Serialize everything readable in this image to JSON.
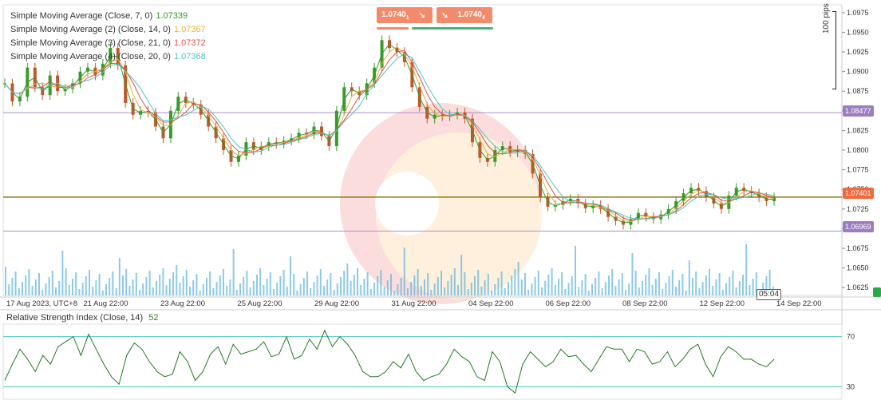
{
  "legend": [
    {
      "label": "Simple Moving Average (Close, 7, 0)",
      "value": "1.07339",
      "color": "#2e9a2e"
    },
    {
      "label": "Simple Moving Average (2) (Close, 14, 0)",
      "value": "1.07367",
      "color": "#e8b23c"
    },
    {
      "label": "Simple Moving Average (3) (Close, 21, 0)",
      "value": "1.07372",
      "color": "#e0504b"
    },
    {
      "label": "Simple Moving Average (4) (Close, 20, 0)",
      "value": "1.07368",
      "color": "#4cc4c0"
    }
  ],
  "trade": {
    "sell_price": "1.0740",
    "sell_sup": "1",
    "buy_price": "1.0740",
    "buy_sup": "4",
    "sell_arrow": "↘",
    "buy_arrow": "↘"
  },
  "pips_label": "100 pips",
  "price_tags": {
    "upper_line": "1.08477",
    "current": "1.07401",
    "lower_line": "1.06969"
  },
  "time_tag": "05:04",
  "rsi_legend": {
    "label": "Relative Strength Index (Close, 14)",
    "value": "52",
    "color": "#2a8a2a"
  },
  "chart_data": {
    "type": "line",
    "title": "",
    "y_axis_ticks": [
      "1.0975",
      "1.0950",
      "1.0925",
      "1.0900",
      "1.0875",
      "1.0850",
      "1.0825",
      "1.0800",
      "1.0775",
      "1.0750",
      "1.0725",
      "1.0700",
      "1.0675",
      "1.0650",
      "1.0625"
    ],
    "ylim": [
      1.0615,
      1.0985
    ],
    "x_axis_ticks": [
      "17 Aug 2023, UTC+8",
      "21 Aug 22:00",
      "23 Aug 22:00",
      "25 Aug 22:00",
      "29 Aug 22:00",
      "31 Aug 22:00",
      "04 Sep 22:00",
      "06 Sep 22:00",
      "08 Sep 22:00",
      "12 Sep 22:00",
      "14 Sep 22:00"
    ],
    "horizontal_levels": [
      1.08477,
      1.07401,
      1.06969
    ],
    "price_series": [
      1.0885,
      1.0862,
      1.0868,
      1.0905,
      1.088,
      1.087,
      1.0895,
      1.0875,
      1.0878,
      1.0885,
      1.09,
      1.0905,
      1.0895,
      1.091,
      1.093,
      1.0908,
      1.086,
      1.0845,
      1.085,
      1.0848,
      1.083,
      1.0815,
      1.085,
      1.0868,
      1.086,
      1.0858,
      1.0845,
      1.083,
      1.0815,
      1.08,
      1.0785,
      1.0793,
      1.081,
      1.08,
      1.0805,
      1.081,
      1.0808,
      1.0812,
      1.0815,
      1.0822,
      1.082,
      1.083,
      1.0818,
      1.0805,
      1.085,
      1.088,
      1.0875,
      1.087,
      1.0885,
      1.0905,
      1.094,
      1.093,
      1.0925,
      1.0912,
      1.088,
      1.0855,
      1.084,
      1.0845,
      1.0843,
      1.0845,
      1.0848,
      1.084,
      1.081,
      1.079,
      1.0785,
      1.08,
      1.0805,
      1.0797,
      1.08,
      1.0795,
      1.077,
      1.074,
      1.0728,
      1.073,
      1.0735,
      1.0738,
      1.0732,
      1.0726,
      1.073,
      1.0725,
      1.0715,
      1.071,
      1.0705,
      1.0712,
      1.072,
      1.0715,
      1.0712,
      1.0718,
      1.0725,
      1.0735,
      1.0745,
      1.0752,
      1.0748,
      1.074,
      1.0732,
      1.0725,
      1.0742,
      1.0752,
      1.0748,
      1.0745,
      1.074,
      1.0735,
      1.074
    ],
    "rsi": {
      "name": "Relative Strength Index (Close, 14)",
      "levels": [
        70,
        30
      ],
      "ylim": [
        20,
        80
      ],
      "values": [
        35,
        48,
        60,
        52,
        42,
        55,
        48,
        62,
        66,
        70,
        55,
        72,
        60,
        48,
        38,
        32,
        55,
        65,
        60,
        50,
        42,
        38,
        40,
        58,
        50,
        35,
        42,
        56,
        62,
        48,
        64,
        56,
        58,
        60,
        66,
        54,
        56,
        70,
        52,
        55,
        68,
        60,
        75,
        62,
        70,
        64,
        55,
        42,
        38,
        38,
        42,
        50,
        45,
        56,
        42,
        35,
        38,
        40,
        48,
        60,
        54,
        50,
        38,
        35,
        58,
        50,
        30,
        25,
        48,
        58,
        52,
        46,
        50,
        60,
        54,
        55,
        48,
        42,
        52,
        62,
        60,
        60,
        50,
        60,
        58,
        48,
        50,
        58,
        46,
        52,
        60,
        64,
        48,
        38,
        54,
        62,
        58,
        52,
        52,
        48,
        46,
        52
      ]
    }
  }
}
